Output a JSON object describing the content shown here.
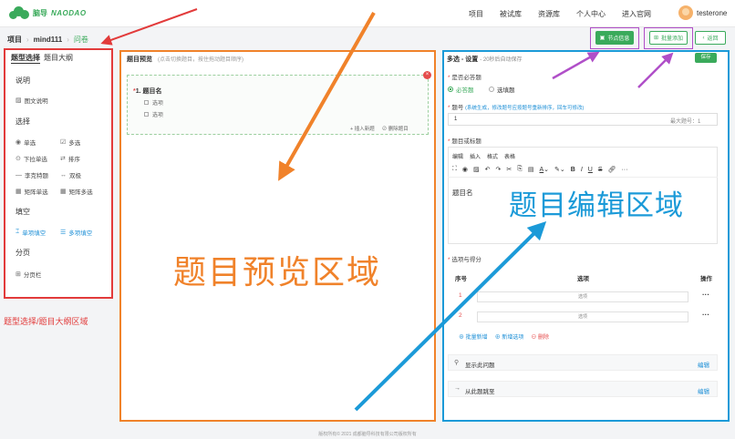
{
  "header": {
    "logo_cn": "脑导",
    "logo_en": "NAODAO",
    "nav": [
      "项目",
      "被试库",
      "资源库",
      "个人中心",
      "进入官网"
    ],
    "username": "testerone"
  },
  "breadcrumb": {
    "root": "项目",
    "project": "mind111",
    "current": "问卷"
  },
  "toolbar": {
    "node_info": "节点信息",
    "batch_add": "批量添加",
    "back": "返回"
  },
  "left": {
    "tabs": [
      "题型选择",
      "题目大纲"
    ],
    "sections": {
      "intro": "说明",
      "choice": "选择",
      "fill": "填空",
      "paging": "分页"
    },
    "items": {
      "image_text": "图文说明",
      "single": "单选",
      "multi": "多选",
      "dropdown": "下拉单选",
      "sort": "排序",
      "unipolar": "李克特题",
      "bipolar": "双极",
      "matrix_single": "矩阵单选",
      "matrix_multi": "矩阵多选",
      "single_fill": "单项填空",
      "multi_fill": "多项填空",
      "page_break": "分页栏"
    },
    "annotation": "题型选择/题目大纲区域"
  },
  "middle": {
    "title": "题目预览",
    "hint": "(点击切换题目，按住拖动题目顺序)",
    "question": {
      "index": "1.",
      "name": "题目名",
      "options": [
        "选项",
        "选项"
      ]
    },
    "insert_new": "插入新题",
    "delete_question": "删除题目",
    "annotation": "题目预览区域"
  },
  "right": {
    "title": "多选 - 设置",
    "autosave": "- 20秒后自动保存",
    "save": "保存",
    "required_label": "是否必答题",
    "required_opts": [
      "必答题",
      "选填题"
    ],
    "number_label": "题号",
    "number_note": "(系统生成，修改题号应按题号重新排序，回车可修改)",
    "number_value": "1",
    "number_max": "最大题号：1",
    "stem_label": "题目或标题",
    "editor_menu": [
      "编辑",
      "插入",
      "格式",
      "表格"
    ],
    "editor_content": "题目名",
    "options_label": "选项与得分",
    "table_headers": {
      "index": "序号",
      "option": "选项",
      "action": "操作"
    },
    "option_rows": [
      {
        "num": "1",
        "value": "选项"
      },
      {
        "num": "2",
        "value": "选项"
      }
    ],
    "batch_add_link": "批量新增",
    "add_option": "新增选项",
    "delete": "删除",
    "show_if": "显示此问题",
    "jump_to": "从此题跳至",
    "edit": "编辑",
    "annotation": "题目编辑区域"
  },
  "footer": "版权所有© 2021 成都脑导科技有限公司版权所有",
  "colors": {
    "brand_green": "#3aaa5b",
    "annot_red": "#e23b3b",
    "annot_orange": "#f0822a",
    "annot_blue": "#1b9ad8",
    "annot_purple": "#b04fc8"
  }
}
